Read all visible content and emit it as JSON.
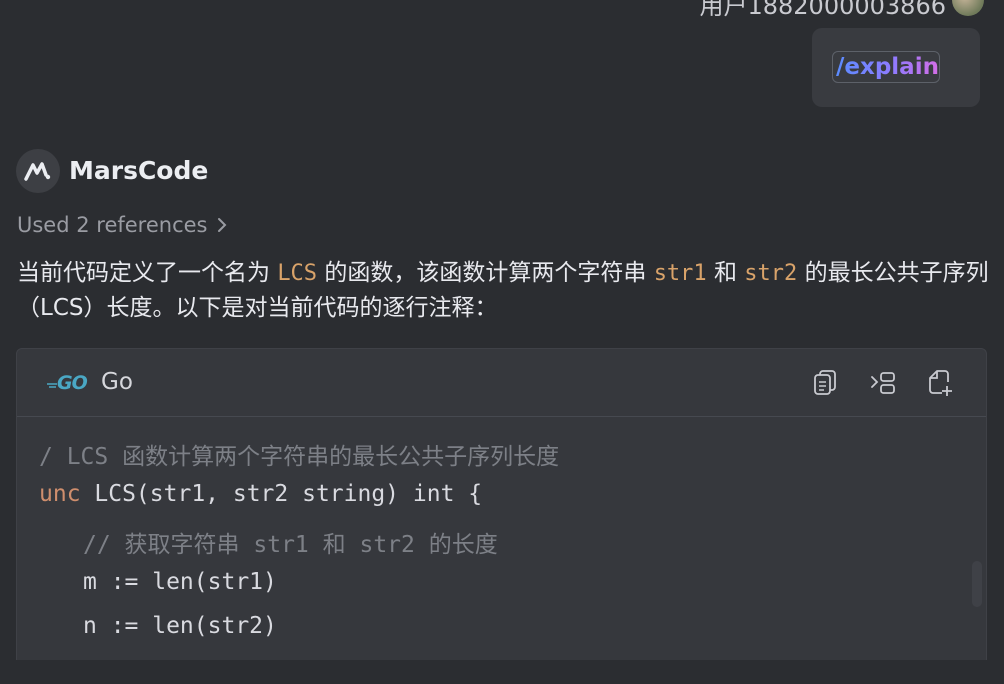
{
  "header": {
    "user_line": "用户1882000003866"
  },
  "user_message": {
    "command": "/explain"
  },
  "bot": {
    "name": "MarsCode",
    "references": "Used 2 references",
    "answer": {
      "t1": "当前代码定义了一个名为",
      "c1": "LCS",
      "t2": "的函数，该函数计算两个字符串",
      "c2": "str1",
      "t3": "和",
      "c3": "str2",
      "t4": "的最长公共子序列（LCS）长度。以下是对当前代码的逐行注释："
    }
  },
  "code_block": {
    "language": "Go",
    "logo": "GO",
    "tools": [
      "copy-icon",
      "insert-icon",
      "new-file-icon"
    ],
    "lines": {
      "l1": "/ LCS 函数计算两个字符串的最长公共子序列长度",
      "l2_kw": "unc",
      "l2": " LCS(str1, str2 string) int {",
      "l3": "// 获取字符串 str1 和 str2 的长度",
      "l4": "m := len(str1)",
      "l5": "n := len(str2)"
    }
  },
  "colors": {
    "background": "#2b2d31",
    "code_background": "#36383d",
    "inline_code": "#d9a36a",
    "keyword": "#cf8e6d",
    "comment": "#7d8087"
  }
}
